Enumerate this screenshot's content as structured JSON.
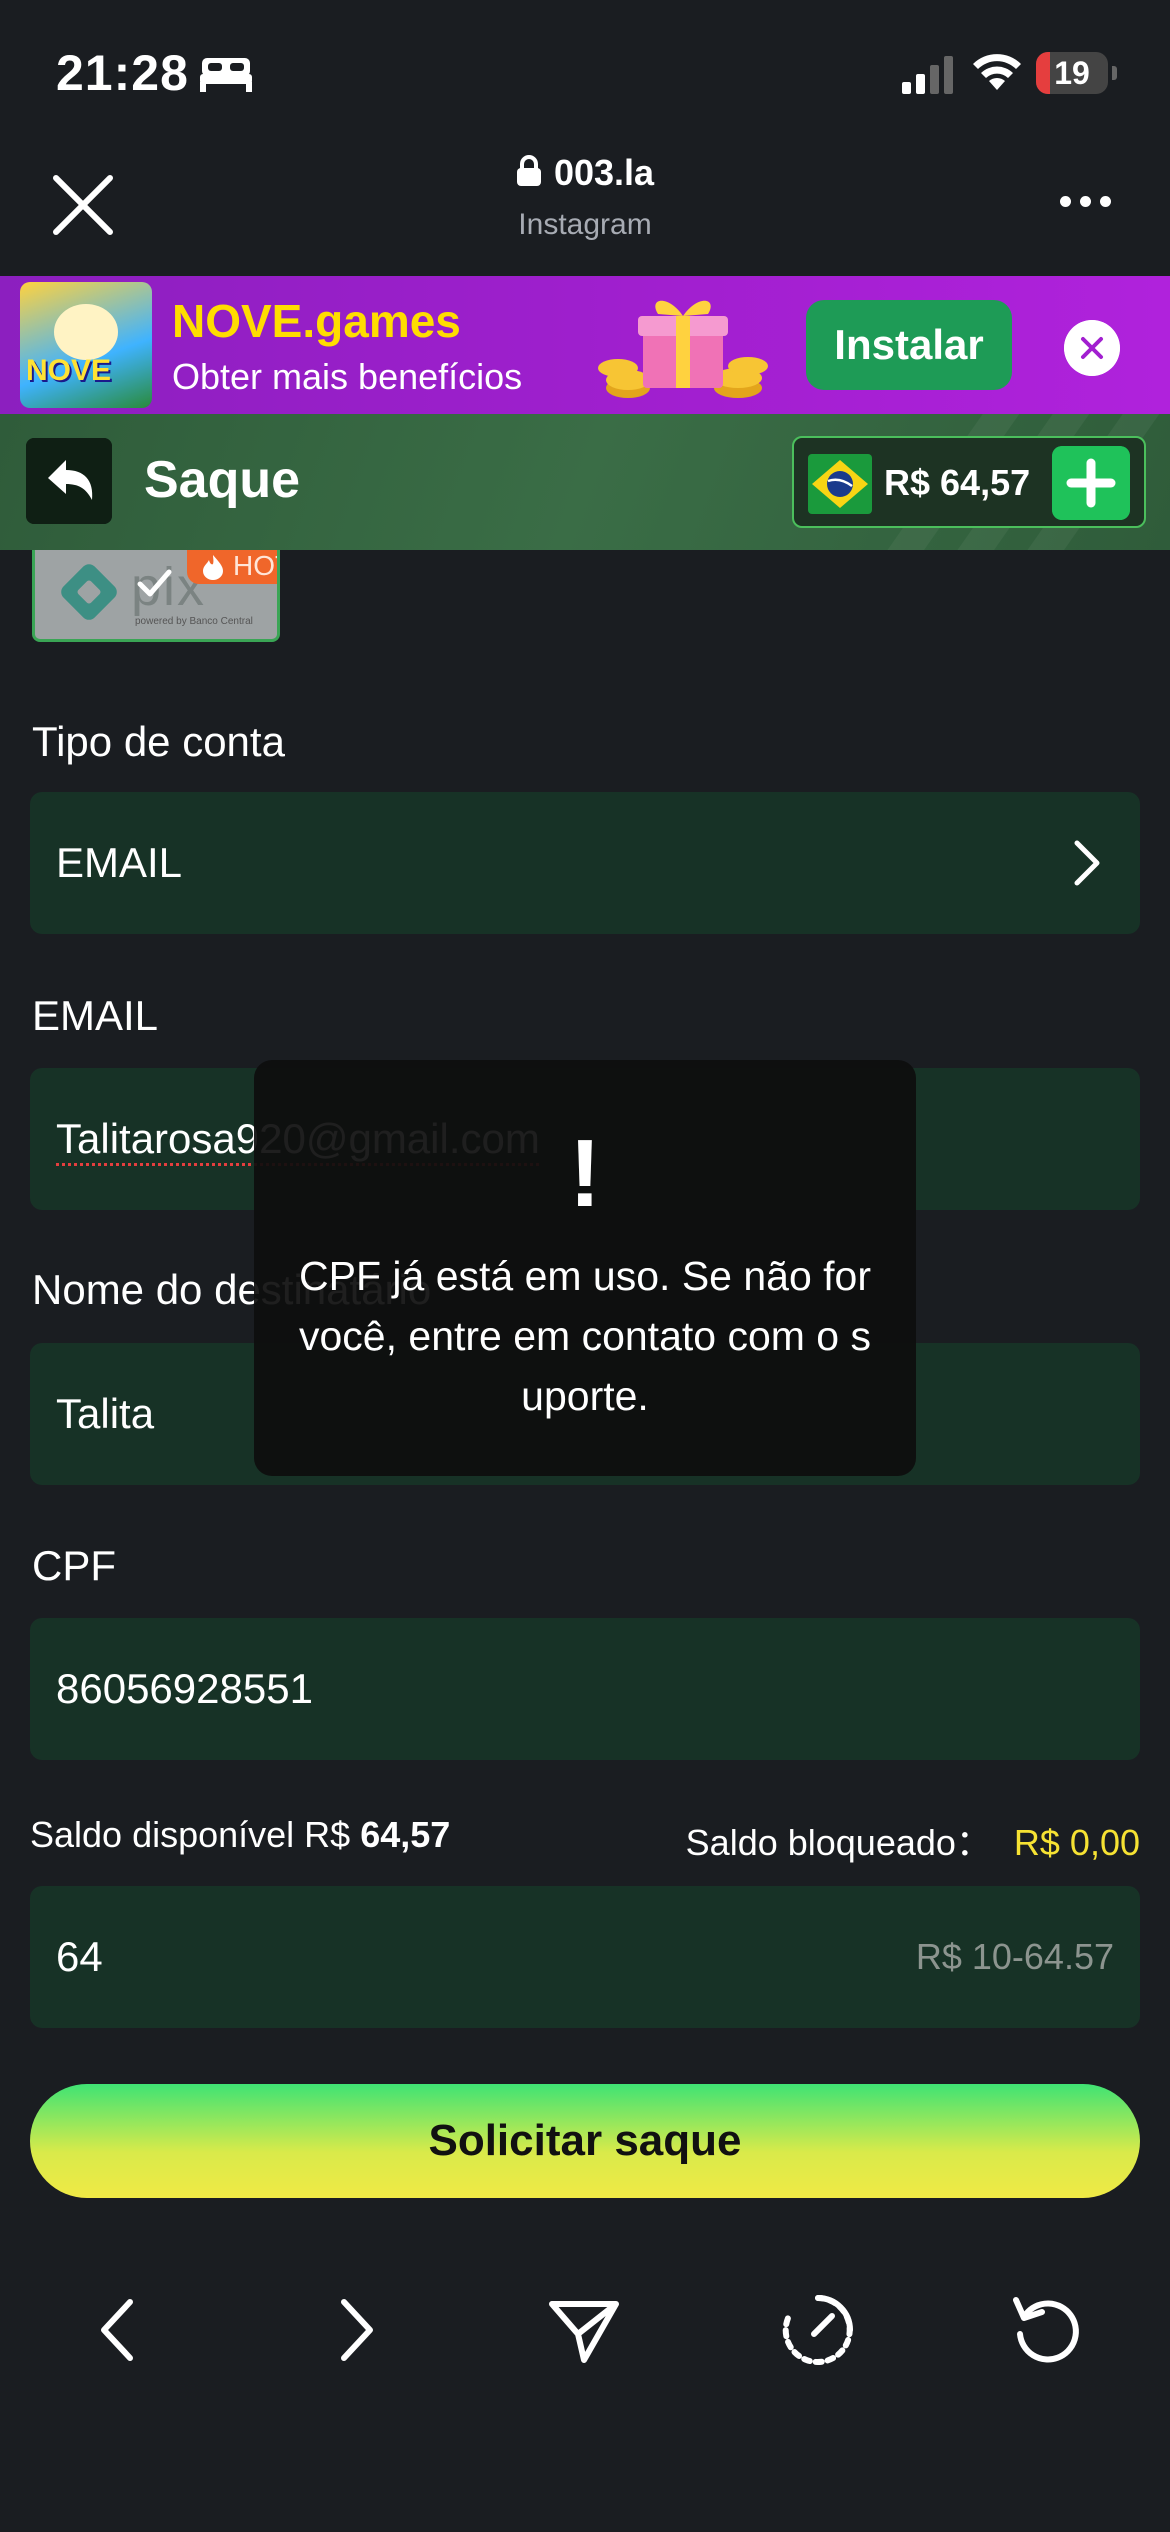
{
  "status_bar": {
    "time": "21:28",
    "battery": "19",
    "battery_level": 0.19,
    "icons": [
      "bed-icon",
      "signal-icon",
      "wifi-icon",
      "battery-icon"
    ]
  },
  "browser": {
    "url": "003.la",
    "source": "Instagram",
    "icons": [
      "close-icon",
      "lock-icon",
      "more-icon"
    ]
  },
  "banner": {
    "title": "NOVE.games",
    "subtitle": "Obter mais benefícios",
    "logo_text": "NOVE",
    "install_label": "Instalar",
    "colors": {
      "background": "#a21fd0",
      "title": "#ffdd00",
      "install": "#1e9b56"
    }
  },
  "header": {
    "title": "Saque",
    "balance": "R$ 64,57",
    "icons": [
      "back-arrow-icon",
      "brazil-flag-icon",
      "plus-icon"
    ]
  },
  "payment_method": {
    "name": "pix",
    "badge": "HOT",
    "sub": "powered by Banco Central"
  },
  "form": {
    "account_type": {
      "label": "Tipo de conta",
      "value": "EMAIL"
    },
    "email": {
      "label": "EMAIL",
      "value": "Talitarosa920@gmail.com"
    },
    "recipient": {
      "label": "Nome do destinatário",
      "value": "Talita"
    },
    "cpf": {
      "label": "CPF",
      "value": "86056928551"
    },
    "amount": {
      "value": "64",
      "hint": "R$ 10-64.57"
    }
  },
  "saldo": {
    "available_label": "Saldo disponível R$",
    "available_value": "64,57",
    "blocked_label": "Saldo bloqueado：",
    "blocked_value": "R$ 0,00"
  },
  "submit_label": "Solicitar saque",
  "toast": {
    "icon": "!",
    "message": "CPF já está em uso. Se não for você, entre em contato com o suporte."
  },
  "toolbar": {
    "icons": [
      "back-icon",
      "forward-icon",
      "share-icon",
      "speed-icon",
      "refresh-icon"
    ]
  },
  "colors": {
    "background": "#1a1d21",
    "field": "#173226",
    "header": "#3a6d46",
    "accent_green": "#1fc25a",
    "blocked_yellow": "#f6e233"
  }
}
